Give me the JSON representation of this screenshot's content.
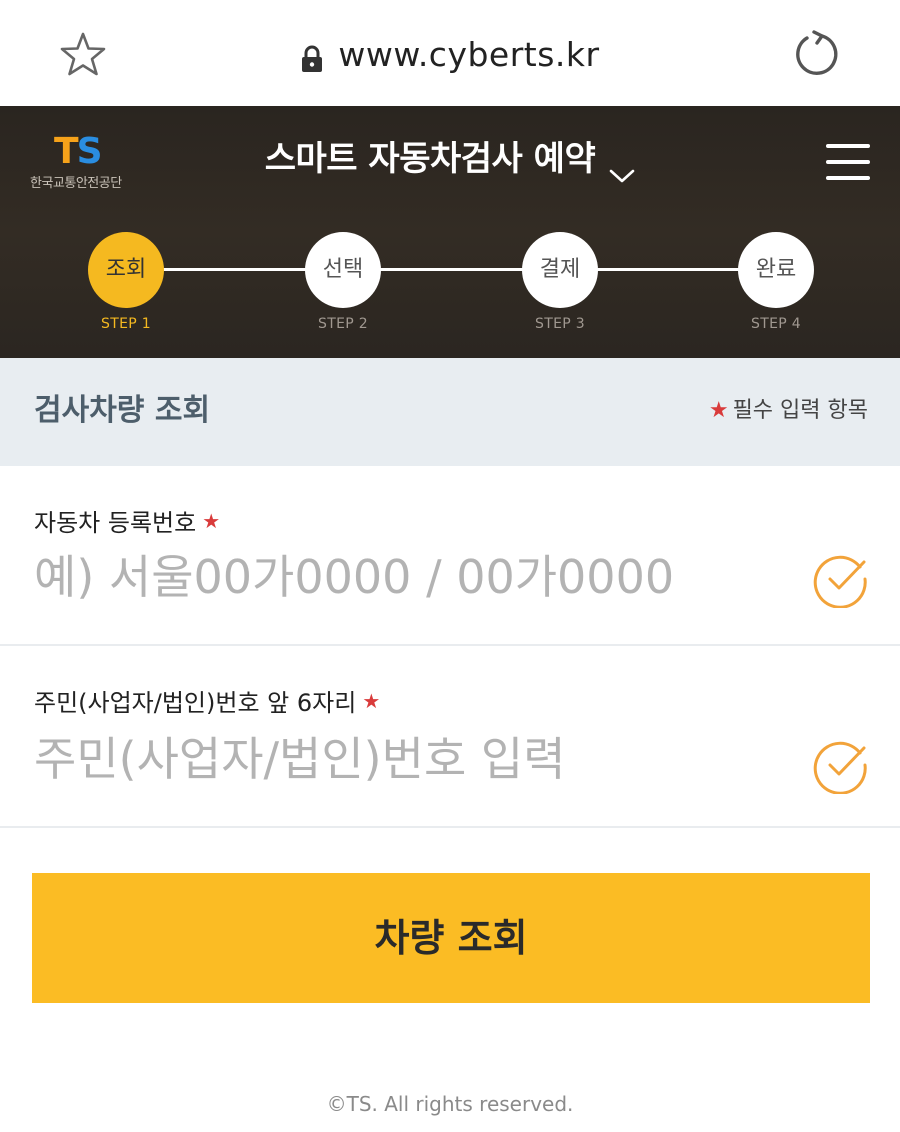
{
  "browser": {
    "url": "www.cyberts.kr"
  },
  "header": {
    "logo_mark_t": "T",
    "logo_mark_s": "S",
    "logo_org": "한국교통안전공단",
    "title": "스마트 자동차검사 예약"
  },
  "steps": [
    {
      "label": "조회",
      "step": "STEP 1",
      "active": true
    },
    {
      "label": "선택",
      "step": "STEP 2",
      "active": false
    },
    {
      "label": "결제",
      "step": "STEP 3",
      "active": false
    },
    {
      "label": "완료",
      "step": "STEP 4",
      "active": false
    }
  ],
  "section": {
    "title": "검사차량 조회",
    "required_mark": "★",
    "required_note": "필수 입력 항목"
  },
  "form": {
    "plate": {
      "label": "자동차 등록번호",
      "required_mark": "★",
      "placeholder": "예) 서울00가0000 / 00가0000",
      "value": ""
    },
    "id": {
      "label": "주민(사업자/법인)번호 앞 6자리",
      "required_mark": "★",
      "placeholder": "주민(사업자/법인)번호 입력",
      "value": ""
    },
    "submit_label": "차량 조회"
  },
  "footer": {
    "copyright": "©TS. All rights reserved."
  },
  "colors": {
    "accent": "#fbbc24",
    "header_bg": "#2e2822",
    "section_bg": "#e8edf1",
    "required": "#d93b3b",
    "check": "#f2a33a"
  },
  "icons": {
    "bookmark": "star-icon",
    "lock": "lock-icon",
    "reload": "reload-icon",
    "title_dropdown": "chevron-down-icon",
    "menu": "hamburger-menu-icon",
    "field_status": "check-circle-icon"
  }
}
